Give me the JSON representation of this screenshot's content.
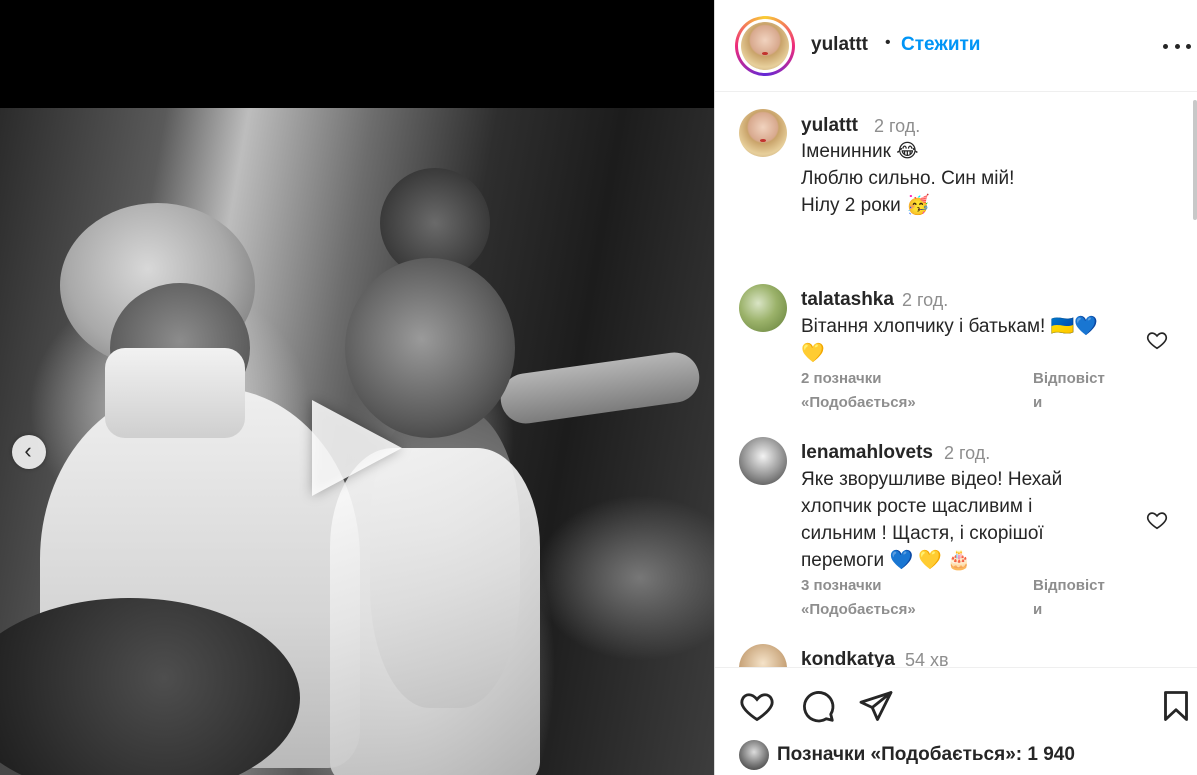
{
  "post": {
    "author": "yulattt",
    "follow_label": "Стежити",
    "separator": "•",
    "caption": {
      "author": "yulattt",
      "time": "2 год.",
      "lines": [
        "Іменинник 😂",
        "Люблю сильно. Син мій!",
        "Нілу 2 роки 🥳"
      ]
    }
  },
  "comments": [
    {
      "author": "talatashka",
      "time": "2 год.",
      "lines": [
        "Вітання хлопчику і батькам! 🇺🇦💙",
        "💛"
      ],
      "likes_label": [
        "2 позначки",
        "«Подобається»"
      ],
      "reply_label": [
        "Відповіст",
        "и"
      ]
    },
    {
      "author": "lenamahlovets",
      "time": "2 год.",
      "lines": [
        "Яке зворушливе відео! Нехай",
        "хлопчик росте щасливим і",
        "сильним ! Щастя, і скорішої",
        "перемоги 💙 💛 🎂"
      ],
      "likes_label": [
        "3 позначки",
        "«Подобається»"
      ],
      "reply_label": [
        "Відповіст",
        "и"
      ]
    },
    {
      "author": "kondkatya",
      "time": "54 хв"
    }
  ],
  "footer": {
    "likes_text": "Позначки «Подобається»: 1 940"
  },
  "icons": {
    "more": "more-options-icon",
    "like": "heart-icon",
    "comment": "comment-bubble-icon",
    "share": "paper-plane-icon",
    "save": "bookmark-icon",
    "play": "play-icon",
    "prev": "chevron-left-icon"
  },
  "colors": {
    "accent": "#0095f6",
    "text": "#262626",
    "muted": "#8e8e8e"
  }
}
